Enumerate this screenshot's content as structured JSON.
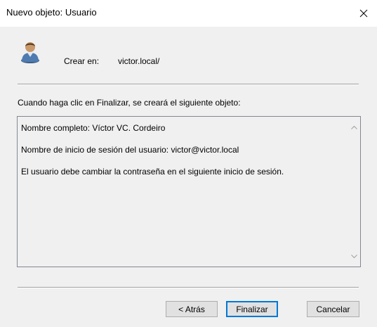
{
  "window": {
    "title": "Nuevo objeto: Usuario",
    "close_icon": "close-icon",
    "accent_color": "#0078d7"
  },
  "header": {
    "icon": "user-icon",
    "label": "Crear en:",
    "value": "victor.local/"
  },
  "info_text": "Cuando haga clic en Finalizar, se creará el siguiente objeto:",
  "summary": {
    "lines": [
      "Nombre completo: Víctor VC. Cordeiro",
      "Nombre de inicio de sesión del usuario: victor@victor.local",
      "El usuario debe cambiar la contraseña en el siguiente inicio de sesión."
    ]
  },
  "buttons": {
    "back": "< Atrás",
    "finish": "Finalizar",
    "cancel": "Cancelar"
  }
}
